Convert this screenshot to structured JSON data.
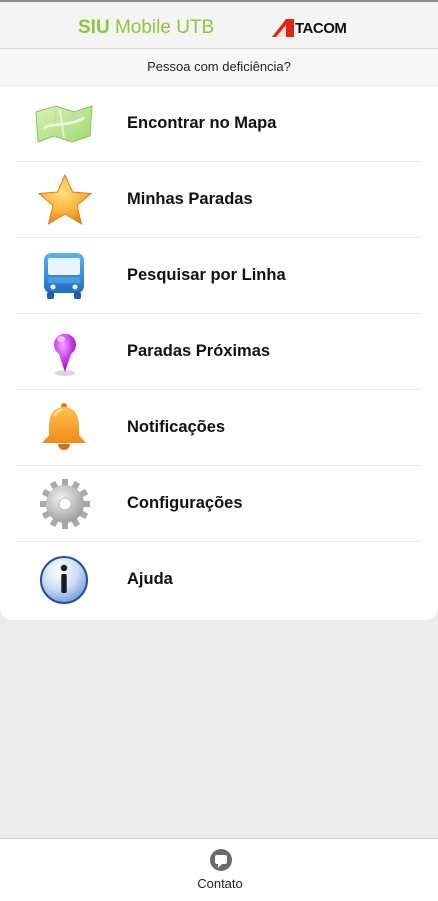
{
  "header": {
    "title_bold": "SIU",
    "title_rest": " Mobile UTB",
    "brand": "TACOM",
    "brand_color": "#e2231a",
    "title_color": "#8cc63f"
  },
  "accessibility_link": "Pessoa com deficiência?",
  "menu": [
    {
      "label": "Encontrar no Mapa",
      "icon": "map-icon"
    },
    {
      "label": "Minhas Paradas",
      "icon": "star-icon"
    },
    {
      "label": "Pesquisar por Linha",
      "icon": "bus-icon"
    },
    {
      "label": "Paradas Próximas",
      "icon": "location-pin-icon"
    },
    {
      "label": "Notificações",
      "icon": "bell-icon"
    },
    {
      "label": "Configurações",
      "icon": "gear-icon"
    },
    {
      "label": "Ajuda",
      "icon": "info-icon"
    }
  ],
  "footer": {
    "contact_label": "Contato",
    "contact_icon": "chat-bubble-icon"
  }
}
